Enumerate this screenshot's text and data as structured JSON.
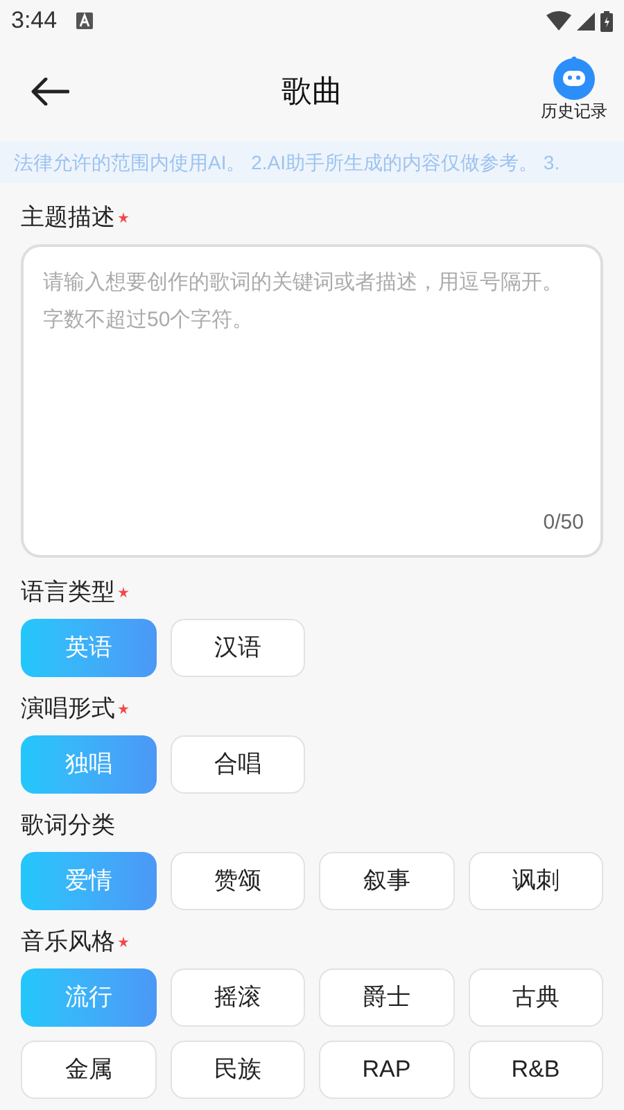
{
  "status_bar": {
    "time": "3:44"
  },
  "header": {
    "title": "歌曲",
    "history_label": "历史记录"
  },
  "notice": "法律允许的范围内使用AI。 2.AI助手所生成的内容仅做参考。 3.",
  "topic": {
    "label": "主题描述",
    "required": true,
    "placeholder": "请输入想要创作的歌词的关键词或者描述，用逗号隔开。字数不超过50个字符。",
    "counter": "0/50"
  },
  "groups": [
    {
      "label": "语言类型",
      "required": true,
      "options": [
        {
          "label": "英语",
          "selected": true
        },
        {
          "label": "汉语",
          "selected": false
        }
      ]
    },
    {
      "label": "演唱形式",
      "required": true,
      "options": [
        {
          "label": "独唱",
          "selected": true
        },
        {
          "label": "合唱",
          "selected": false
        }
      ]
    },
    {
      "label": "歌词分类",
      "required": false,
      "options": [
        {
          "label": "爱情",
          "selected": true
        },
        {
          "label": "赞颂",
          "selected": false
        },
        {
          "label": "叙事",
          "selected": false
        },
        {
          "label": "讽刺",
          "selected": false
        }
      ]
    },
    {
      "label": "音乐风格",
      "required": true,
      "options": [
        {
          "label": "流行",
          "selected": true
        },
        {
          "label": "摇滚",
          "selected": false
        },
        {
          "label": "爵士",
          "selected": false
        },
        {
          "label": "古典",
          "selected": false
        },
        {
          "label": "金属",
          "selected": false
        },
        {
          "label": "民族",
          "selected": false
        },
        {
          "label": "RAP",
          "selected": false
        },
        {
          "label": "R&B",
          "selected": false
        }
      ]
    }
  ]
}
